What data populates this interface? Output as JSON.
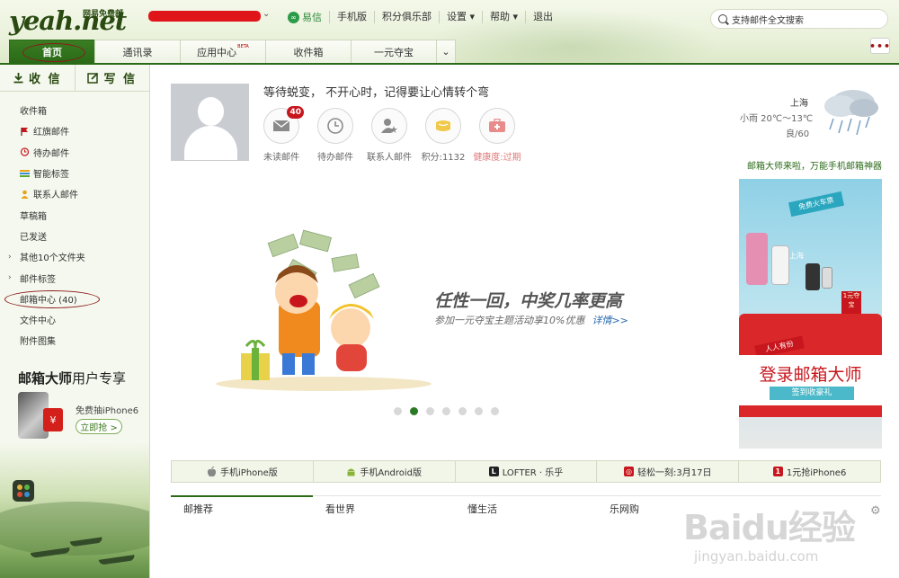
{
  "header": {
    "logo": "yeah.net",
    "logo_sub": "网易免费邮",
    "nav": [
      "易信",
      "手机版",
      "积分俱乐部",
      "设置",
      "帮助",
      "退出"
    ],
    "search_placeholder": "支持邮件全文搜索"
  },
  "tabs": [
    {
      "label": "首页",
      "active": true
    },
    {
      "label": "通讯录"
    },
    {
      "label": "应用中心",
      "badge": "BETA"
    },
    {
      "label": "收件箱"
    },
    {
      "label": "一元夺宝"
    }
  ],
  "sidebar": {
    "receive_label": "收 信",
    "compose_label": "写 信",
    "folders": [
      {
        "label": "收件箱"
      },
      {
        "label": "红旗邮件",
        "icon": "flag-icon"
      },
      {
        "label": "待办邮件",
        "icon": "clock-icon"
      },
      {
        "label": "智能标签",
        "icon": "tag-icon"
      },
      {
        "label": "联系人邮件",
        "icon": "contact-icon"
      },
      {
        "label": "草稿箱"
      },
      {
        "label": "已发送"
      },
      {
        "label": "其他10个文件夹",
        "expandable": true
      },
      {
        "label": "邮件标签",
        "expandable": true
      },
      {
        "label": "邮箱中心 (40)"
      },
      {
        "label": "文件中心"
      },
      {
        "label": "附件图集"
      }
    ],
    "promo": {
      "title_bold": "邮箱大师",
      "title_rest": "用户专享",
      "text": "免费抽iPhone6",
      "badge": "¥",
      "button": "立即抢 >"
    }
  },
  "profile": {
    "motto": "等待蜕变， 不开心时，记得要让心情转个弯",
    "stats": [
      {
        "label": "未读邮件",
        "badge": "40",
        "icon": "mail-icon"
      },
      {
        "label": "待办邮件",
        "icon": "clock-icon"
      },
      {
        "label": "联系人邮件",
        "icon": "contact-star-icon"
      },
      {
        "label": "积分:1132",
        "icon": "coin-icon"
      },
      {
        "label": "健康度:过期",
        "icon": "medkit-icon"
      }
    ]
  },
  "weather": {
    "city": "上海",
    "desc": "小雨 20℃～13℃",
    "aqi": "良/60"
  },
  "ad": {
    "title": "邮箱大师来啦，万能手机邮箱神器",
    "tag": "免费火车票",
    "city": "上海",
    "red_tag": "人人有份",
    "gift_tag": "1元夺宝",
    "big": "登录邮箱大师",
    "small": "签到收豪礼"
  },
  "banner": {
    "title": "任性一回，中奖几率更高",
    "sub": "参加一元夺宝主题活动享10%优惠",
    "link": "详情>>",
    "dots": 7,
    "active_dot": 2
  },
  "appbar": [
    {
      "label": "手机iPhone版",
      "icon": "apple-icon",
      "color": "#888888"
    },
    {
      "label": "手机Android版",
      "icon": "android-icon",
      "color": "#8ab33b"
    },
    {
      "label": "LOFTER · 乐乎",
      "icon": "lofter-icon",
      "color": "#222222",
      "glyph": "L"
    },
    {
      "label": "轻松一刻:3月17日",
      "icon": "spiral-icon",
      "color": "#c7161d",
      "glyph": "◎"
    },
    {
      "label": "1元抢iPhone6",
      "icon": "one-yuan-icon",
      "color": "#c7161d",
      "glyph": "1"
    }
  ],
  "content_tabs": [
    {
      "label": "邮推荐",
      "active": true
    },
    {
      "label": "看世界"
    },
    {
      "label": "懂生活"
    },
    {
      "label": "乐网购"
    }
  ],
  "watermark": {
    "brand": "Baidu经验",
    "url": "jingyan.baidu.com"
  }
}
